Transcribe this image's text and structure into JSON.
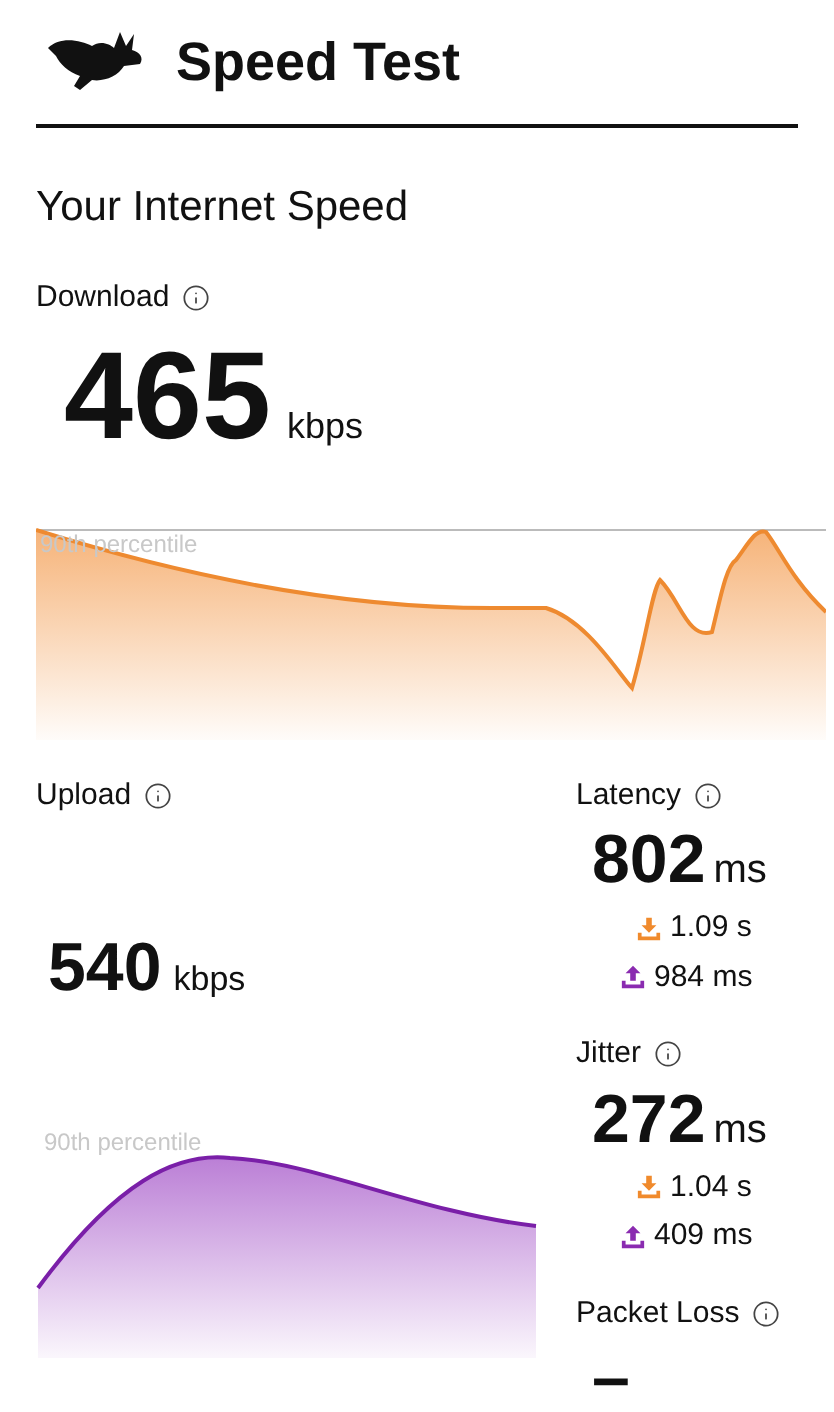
{
  "header": {
    "title": "Speed Test"
  },
  "heading": "Your Internet Speed",
  "download": {
    "label": "Download",
    "value": "465",
    "unit": "kbps",
    "threshold_label": "90th percentile"
  },
  "upload": {
    "label": "Upload",
    "value": "540",
    "unit": "kbps",
    "threshold_label": "90th percentile"
  },
  "metrics": [
    {
      "label": "Latency",
      "value": "802",
      "unit": "ms",
      "download": "1.09 s",
      "upload": "984 ms"
    },
    {
      "label": "Jitter",
      "value": "272",
      "unit": "ms",
      "download": "1.04 s",
      "upload": "409 ms"
    },
    {
      "label": "Packet Loss",
      "value": "–"
    }
  ]
}
